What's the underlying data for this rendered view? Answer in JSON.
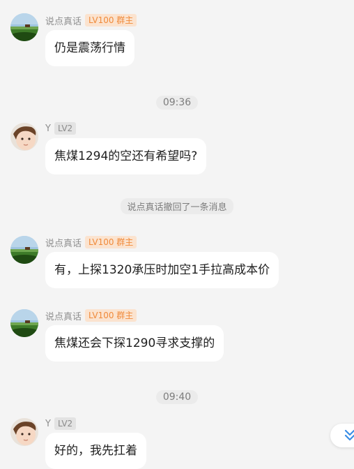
{
  "messages": [
    {
      "sender": "说点真话",
      "badge": "LV100 群主",
      "role": "owner",
      "text": "仍是震荡行情"
    },
    {
      "sender": "Y",
      "badge": "LV2",
      "role": "member",
      "text": "焦煤1294的空还有希望吗?"
    },
    {
      "sender": "说点真话",
      "badge": "LV100 群主",
      "role": "owner",
      "text": "有，上探1320承压时加空1手拉高成本价"
    },
    {
      "sender": "说点真话",
      "badge": "LV100 群主",
      "role": "owner",
      "text": "焦煤还会下探1290寻求支撑的"
    },
    {
      "sender": "Y",
      "badge": "LV2",
      "role": "member",
      "text": "好的，我先扛着"
    }
  ],
  "timestamps": [
    "09:36",
    "09:40"
  ],
  "system_notice": "说点真话撤回了一条消息",
  "icons": {
    "owner_avatar": "landscape-avatar-icon",
    "member_avatar": "baby-avatar-icon",
    "scroll": "chevron-double-down-icon"
  },
  "colors": {
    "background": "#f4f4f4",
    "bubble": "#ffffff",
    "owner_badge_bg": "#fbe3cf",
    "owner_badge_text": "#f08a3a",
    "member_badge_bg": "#e3e3e3",
    "accent_blue": "#3a8ee6"
  }
}
